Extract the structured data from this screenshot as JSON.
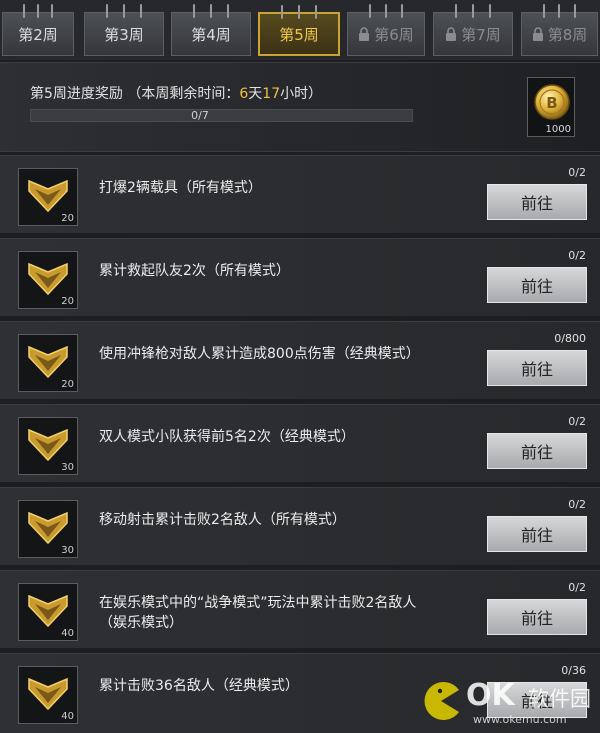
{
  "tabs": [
    {
      "label": "第2周",
      "state": "normal"
    },
    {
      "label": "第3周",
      "state": "normal"
    },
    {
      "label": "第4周",
      "state": "normal"
    },
    {
      "label": "第5周",
      "state": "active"
    },
    {
      "label": "第6周",
      "state": "locked"
    },
    {
      "label": "第7周",
      "state": "locked"
    },
    {
      "label": "第8周",
      "state": "locked"
    }
  ],
  "reward": {
    "title_prefix": "第5周进度奖励 （本周剩余时间：",
    "days": "6",
    "day_unit": "天",
    "hours": "17",
    "hour_unit": "小时）",
    "progress_text": "0/7",
    "progress_fraction": 0,
    "coin_amount": "1000"
  },
  "tasks": [
    {
      "text": "打爆2辆载具（所有模式）",
      "count": "0/2",
      "icon_num": "20",
      "button": "前往"
    },
    {
      "text": "累计救起队友2次（所有模式）",
      "count": "0/2",
      "icon_num": "20",
      "button": "前往"
    },
    {
      "text": "使用冲锋枪对敌人累计造成800点伤害（经典模式）",
      "count": "0/800",
      "icon_num": "20",
      "button": "前往"
    },
    {
      "text": "双人模式小队获得前5名2次（经典模式）",
      "count": "0/2",
      "icon_num": "30",
      "button": "前往"
    },
    {
      "text": "移动射击累计击败2名敌人（所有模式）",
      "count": "0/2",
      "icon_num": "30",
      "button": "前往"
    },
    {
      "text": "在娱乐模式中的“战争模式”玩法中累计击败2名敌人（娱乐模式）",
      "count": "0/2",
      "icon_num": "40",
      "button": "前往"
    },
    {
      "text": "累计击败36名敌人（经典模式）",
      "count": "0/36",
      "icon_num": "40",
      "button": "前往"
    }
  ],
  "watermark": {
    "main": "OK",
    "cn": "软件园",
    "url": "www.okemu.com"
  },
  "colors": {
    "accent_gold": "#f0c040",
    "active_border": "#c9a334",
    "background": "#1c1e21"
  },
  "icons": {
    "lock": "lock-icon",
    "chevron_badge": "chevron-rank-icon",
    "coin": "coin-icon"
  }
}
